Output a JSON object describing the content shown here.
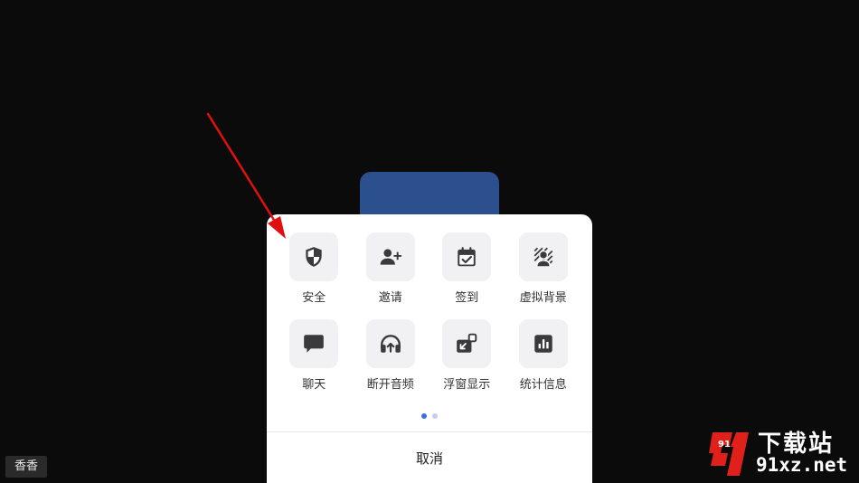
{
  "menu": {
    "items": [
      {
        "label": "安全",
        "icon": "shield-icon"
      },
      {
        "label": "邀请",
        "icon": "add-user-icon"
      },
      {
        "label": "签到",
        "icon": "calendar-check-icon"
      },
      {
        "label": "虚拟背景",
        "icon": "virtual-background-icon"
      },
      {
        "label": "聊天",
        "icon": "chat-icon"
      },
      {
        "label": "断开音频",
        "icon": "headphones-icon"
      },
      {
        "label": "浮窗显示",
        "icon": "floating-window-icon"
      },
      {
        "label": "统计信息",
        "icon": "statistics-icon"
      }
    ],
    "page_count": 2,
    "current_page": 1,
    "cancel_label": "取消"
  },
  "participant": {
    "name": "香香",
    "tile_color": "#2c4f8e"
  },
  "watermark": {
    "mark": "91",
    "title": "下载站",
    "url": "91xz.net"
  },
  "colors": {
    "background": "#0b0b0b",
    "sheet": "#ffffff",
    "icon_tile": "#f1f1f4",
    "icon": "#3a3a3c",
    "active_dot": "#3d6fe0",
    "inactive_dot": "#c5cde8",
    "annotation_arrow": "#e01010",
    "watermark_red": "#e0201a"
  }
}
